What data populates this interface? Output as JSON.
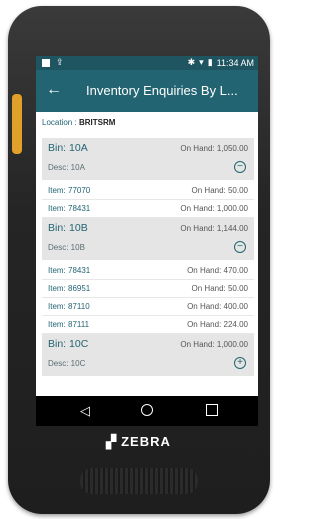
{
  "status": {
    "time": "11:34 AM"
  },
  "header": {
    "title": "Inventory Enquiries By L..."
  },
  "location": {
    "label": "Location :",
    "value": "BRITSRM"
  },
  "bins": [
    {
      "name": "Bin: 10A",
      "desc": "Desc: 10A",
      "onhand": "On Hand: 1,050.00",
      "toggle": "⊖",
      "items": [
        {
          "item": "Item: 77070",
          "onhand": "On Hand: 50.00"
        },
        {
          "item": "Item: 78431",
          "onhand": "On Hand: 1,000.00"
        }
      ]
    },
    {
      "name": "Bin: 10B",
      "desc": "Desc: 10B",
      "onhand": "On Hand: 1,144.00",
      "toggle": "⊖",
      "items": [
        {
          "item": "Item: 78431",
          "onhand": "On Hand: 470.00"
        },
        {
          "item": "Item: 86951",
          "onhand": "On Hand: 50.00"
        },
        {
          "item": "Item: 87110",
          "onhand": "On Hand: 400.00"
        },
        {
          "item": "Item: 87111",
          "onhand": "On Hand: 224.00"
        }
      ]
    },
    {
      "name": "Bin: 10C",
      "desc": "Desc: 10C",
      "onhand": "On Hand: 1,000.00",
      "toggle": "⊕",
      "items": []
    }
  ],
  "brand": {
    "name": "ZEBRA"
  },
  "colors": {
    "appbar": "#236473",
    "statusbar": "#1e5560",
    "accent": "#236473"
  }
}
